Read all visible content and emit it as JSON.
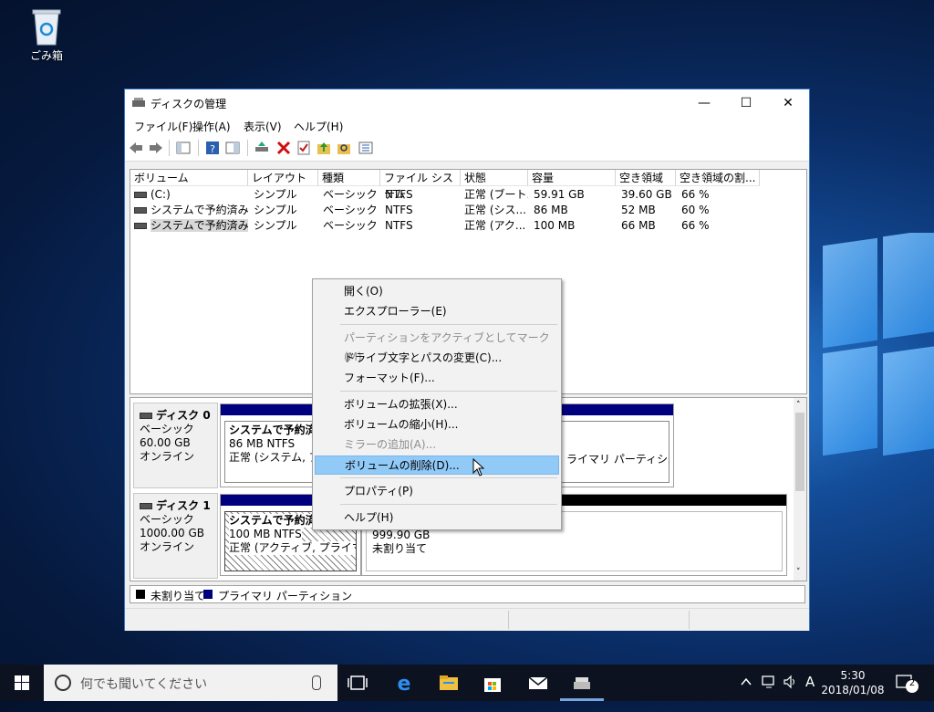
{
  "desktop": {
    "recycle_bin_label": "ごみ箱"
  },
  "window": {
    "title": "ディスクの管理",
    "controls": {
      "minimize": "—",
      "maximize": "☐",
      "close": "✕"
    },
    "menu": [
      "ファイル(F)",
      "操作(A)",
      "表示(V)",
      "ヘルプ(H)"
    ],
    "columns": [
      "ボリューム",
      "レイアウト",
      "種類",
      "ファイル システム",
      "状態",
      "容量",
      "空き領域",
      "空き領域の割..."
    ],
    "rows": [
      [
        "(C:)",
        "シンプル",
        "ベーシック",
        "NTFS",
        "正常 (ブート...",
        "59.91 GB",
        "39.60 GB",
        "66 %"
      ],
      [
        "システムで予約済み",
        "シンプル",
        "ベーシック",
        "NTFS",
        "正常 (シス...",
        "86 MB",
        "52 MB",
        "60 %"
      ],
      [
        "システムで予約済み ...",
        "シンプル",
        "ベーシック",
        "NTFS",
        "正常 (アク...",
        "100 MB",
        "66 MB",
        "66 %"
      ]
    ],
    "disks": [
      {
        "name": "ディスク 0",
        "type": "ベーシック",
        "size": "60.00 GB",
        "status": "オンライン",
        "part1": {
          "name": "システムで予約済み",
          "info": "86 MB NTFS",
          "status": "正常 (システム, アクテ"
        },
        "part2_status": "ライマリ パーティション)"
      },
      {
        "name": "ディスク 1",
        "type": "ベーシック",
        "size": "1000.00 GB",
        "status": "オンライン",
        "part1": {
          "name": "システムで予約済み",
          "info": "100 MB NTFS",
          "status": "正常 (アクティブ, プライマリ パー"
        },
        "part2": {
          "size": "999.90 GB",
          "label": "未割り当て"
        }
      }
    ],
    "legend": {
      "unallocated": "未割り当て",
      "primary": "プライマリ パーティション"
    },
    "colors": {
      "primary": "#00007f",
      "unallocated": "#000000"
    }
  },
  "context_menu": {
    "items": [
      {
        "label": "開く(O)",
        "enabled": true
      },
      {
        "label": "エクスプローラー(E)",
        "enabled": true
      },
      {
        "label": "パーティションをアクティブとしてマーク(M)",
        "enabled": false
      },
      {
        "label": "ドライブ文字とパスの変更(C)...",
        "enabled": true
      },
      {
        "label": "フォーマット(F)...",
        "enabled": true
      },
      {
        "label": "ボリュームの拡張(X)...",
        "enabled": true
      },
      {
        "label": "ボリュームの縮小(H)...",
        "enabled": true
      },
      {
        "label": "ミラーの追加(A)...",
        "enabled": false
      },
      {
        "label": "ボリュームの削除(D)...",
        "enabled": true,
        "highlighted": true
      },
      {
        "label": "プロパティ(P)",
        "enabled": true
      },
      {
        "label": "ヘルプ(H)",
        "enabled": true
      }
    ]
  },
  "taskbar": {
    "search_placeholder": "何でも聞いてください",
    "ime": "A",
    "time": "5:30",
    "date": "2018/01/08",
    "notifications": "2"
  }
}
